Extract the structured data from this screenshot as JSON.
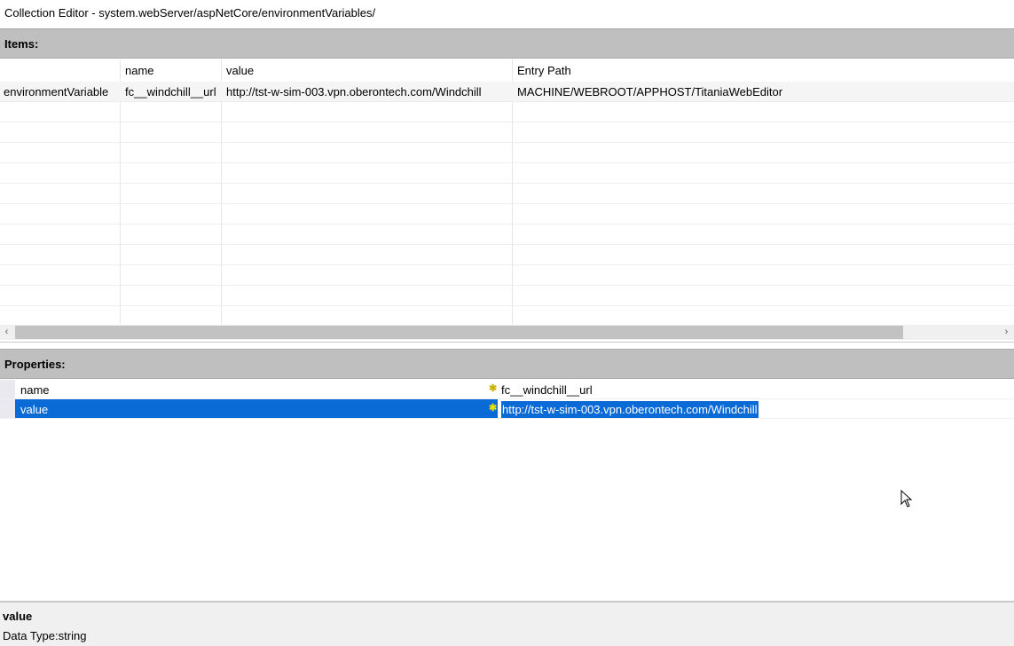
{
  "window": {
    "title": "Collection Editor - system.webServer/aspNetCore/environmentVariables/"
  },
  "items": {
    "header": "Items:",
    "columns": [
      "",
      "name",
      "value",
      "Entry Path"
    ],
    "rows": [
      [
        "environmentVariable",
        "fc__windchill__url",
        "http://tst-w-sim-003.vpn.oberontech.com/Windchill",
        "MACHINE/WEBROOT/APPHOST/TitaniaWebEditor"
      ]
    ]
  },
  "properties": {
    "header": "Properties:",
    "rows": [
      {
        "name": "name",
        "value": "fc__windchill__url",
        "selected": false
      },
      {
        "name": "value",
        "value": "http://tst-w-sim-003.vpn.oberontech.com/Windchill",
        "selected": true
      }
    ]
  },
  "footer": {
    "name": "value",
    "type": "Data Type:string"
  },
  "colors": {
    "selection": "#0a6ad6",
    "section_header": "#bfbfbf",
    "modified_star": "#c8b400"
  },
  "icons": {
    "scroll_left": "chevron-left-icon",
    "scroll_right": "chevron-right-icon",
    "cursor": "mouse-pointer-icon"
  }
}
